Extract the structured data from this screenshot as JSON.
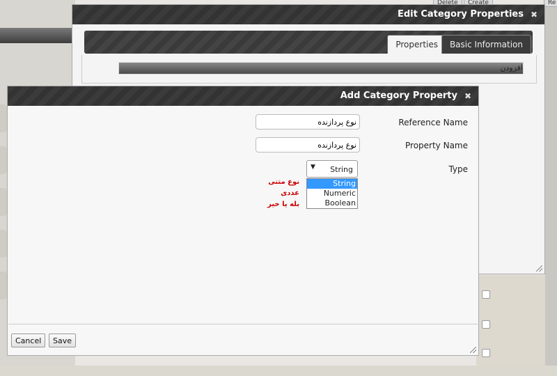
{
  "background": {
    "top_buttons": [
      "Delete",
      "Create",
      "Re"
    ]
  },
  "edit_dialog": {
    "title": "Edit Category Properties",
    "close_glyph": "✖",
    "tabs": [
      {
        "label": "Properties",
        "active": true
      },
      {
        "label": "Basic Information",
        "active": false
      }
    ],
    "add_label": "افزودن"
  },
  "add_dialog": {
    "title": "Add Category Property",
    "close_glyph": "✖",
    "fields": {
      "reference_name": {
        "label": "Reference Name",
        "value": "نوع پردازنده"
      },
      "property_name": {
        "label": "Property Name",
        "value": "نوع پردازنده"
      },
      "type": {
        "label": "Type",
        "selected": "String",
        "arrow": "▼",
        "options": [
          "String",
          "Numeric",
          "Boolean"
        ]
      }
    },
    "hints": [
      "نوع متنی",
      "عددی",
      "بله یا خیر"
    ],
    "buttons": {
      "cancel": "Cancel",
      "save": "Save"
    }
  },
  "colors": {
    "titlebar": "#333333",
    "hint_text": "#cc0000",
    "selected_option": "#3399ff"
  }
}
